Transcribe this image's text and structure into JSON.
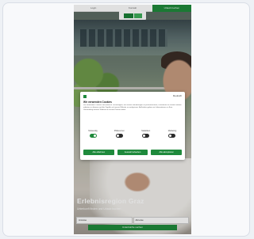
{
  "topbar": {
    "items": [
      {
        "label": "Login"
      },
      {
        "label": "Kontakt"
      },
      {
        "label": "Urlaub buchen"
      }
    ]
  },
  "hero": {
    "title": "Erlebnisregion Graz",
    "subtitle": "Unterkunft finden und Urlaub buchen"
  },
  "search": {
    "arrival_placeholder": "Anreise",
    "departure_placeholder": "Abreise",
    "button_label": "Unterkünfte suchen"
  },
  "cookie_modal": {
    "language": "Deutsch",
    "title": "Wir verwenden Cookies",
    "text": "Wir verwenden Cookies und ähnliche Technologien, um Inhalte und Anzeigen zu personalisieren, Funktionen für soziale Medien anbieten zu können und die Zugriffe auf unsere Website zu analysieren. Außerdem geben wir Informationen zu Ihrer Verwendung unserer Website an unsere Partner weiter.",
    "toggles": [
      {
        "label": "Notwendig",
        "on": true
      },
      {
        "label": "Präferenzen",
        "on": false
      },
      {
        "label": "Statistiken",
        "on": false
      },
      {
        "label": "Marketing",
        "on": false
      }
    ],
    "buttons": [
      {
        "label": "Alle ablehnen"
      },
      {
        "label": "Auswahl erlauben"
      },
      {
        "label": "Alle akzeptieren"
      }
    ]
  },
  "colors": {
    "accent": "#1f8a3c",
    "background": "#eef1f5"
  }
}
